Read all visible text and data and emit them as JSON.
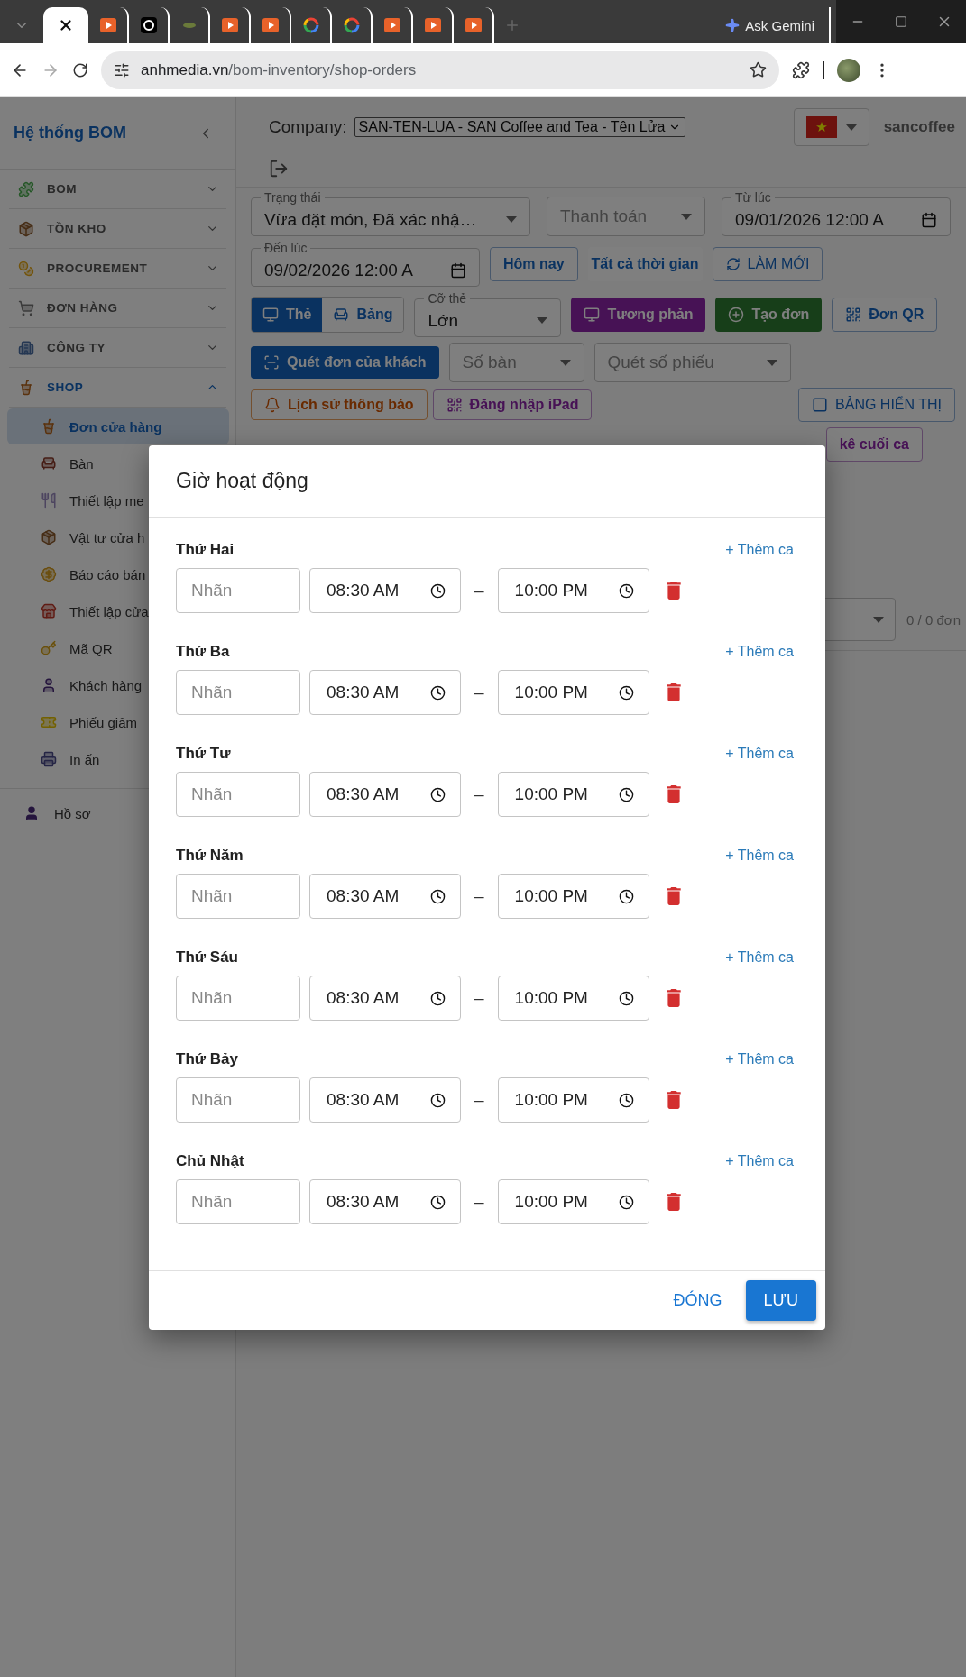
{
  "browser": {
    "tabs": [
      {
        "selected": true
      },
      {
        "selected": false
      },
      {
        "selected": false
      },
      {
        "selected": false
      },
      {
        "selected": false
      },
      {
        "selected": false
      },
      {
        "selected": false
      },
      {
        "selected": false
      },
      {
        "selected": false
      },
      {
        "selected": false
      },
      {
        "selected": false
      }
    ],
    "gemini": "Ask Gemini",
    "url_domain": "anhmedia.vn",
    "url_path": "/bom-inventory/shop-orders"
  },
  "sidebar": {
    "title": "Hệ thống BOM",
    "sections": [
      {
        "label": "BOM",
        "expanded": false
      },
      {
        "label": "TỒN KHO",
        "expanded": false
      },
      {
        "label": "PROCUREMENT",
        "expanded": false
      },
      {
        "label": "ĐƠN HÀNG",
        "expanded": false
      },
      {
        "label": "CÔNG TY",
        "expanded": false
      },
      {
        "label": "SHOP",
        "expanded": true,
        "children": [
          {
            "label": "Đơn cửa hàng",
            "selected": true
          },
          {
            "label": "Bàn",
            "selected": false
          },
          {
            "label": "Thiết lập me",
            "selected": false
          },
          {
            "label": "Vật tư cửa h",
            "selected": false
          },
          {
            "label": "Báo cáo bán",
            "selected": false
          },
          {
            "label": "Thiết lập cửa",
            "selected": false
          },
          {
            "label": "Mã QR",
            "selected": false
          },
          {
            "label": "Khách hàng",
            "selected": false
          },
          {
            "label": "Phiếu giảm",
            "selected": false
          },
          {
            "label": "In ấn",
            "selected": false
          }
        ]
      }
    ],
    "profile": "Hồ sơ"
  },
  "header": {
    "company_label": "Company:",
    "company": "SAN-TEN-LUA - SAN Coffee and Tea - Tên Lửa",
    "user": "sancoffee"
  },
  "filters": {
    "status": {
      "label": "Trạng thái",
      "value": "Vừa đặt món, Đã xác nhậ…"
    },
    "payment": {
      "placeholder": "Thanh toán"
    },
    "from": {
      "label": "Từ lúc",
      "value": "09/01/2026 12:00 A"
    },
    "to": {
      "label": "Đến lúc",
      "value": "09/02/2026 12:00 A"
    },
    "today": "Hôm nay",
    "all_time": "Tất cả thời gian",
    "refresh": "LÀM MỚI"
  },
  "view_modes": [
    {
      "label": "Thẻ",
      "selected": true
    },
    {
      "label": "Bảng",
      "selected": false
    }
  ],
  "card_size": {
    "label": "Cỡ thẻ",
    "value": "Lớn"
  },
  "actions": {
    "contrast": "Tương phản",
    "create": "Tạo đơn",
    "qr": "Đơn QR",
    "scan": "Quét đơn của khách",
    "table_placeholder": "Số bàn",
    "ticket_placeholder": "Quét số phiếu",
    "history": "Lịch sử thông báo",
    "ipad": "Đăng nhập iPad",
    "display": "BẢNG HIỂN THỊ",
    "shift_report": "kê cuối ca"
  },
  "order_count": "0 / 0 đơn",
  "dialog": {
    "title": "Giờ hoạt động",
    "days": [
      {
        "name": "Thứ Hai",
        "add_shift": "+ Thêm ca",
        "shifts": [
          {
            "placeholder": "Nhãn",
            "start": "08:30 AM",
            "dash": "–",
            "end": "10:00 PM"
          }
        ]
      },
      {
        "name": "Thứ Ba",
        "add_shift": "+ Thêm ca",
        "shifts": [
          {
            "placeholder": "Nhãn",
            "start": "08:30 AM",
            "dash": "–",
            "end": "10:00 PM"
          }
        ]
      },
      {
        "name": "Thứ Tư",
        "add_shift": "+ Thêm ca",
        "shifts": [
          {
            "placeholder": "Nhãn",
            "start": "08:30 AM",
            "dash": "–",
            "end": "10:00 PM"
          }
        ]
      },
      {
        "name": "Thứ Năm",
        "add_shift": "+ Thêm ca",
        "shifts": [
          {
            "placeholder": "Nhãn",
            "start": "08:30 AM",
            "dash": "–",
            "end": "10:00 PM"
          }
        ]
      },
      {
        "name": "Thứ Sáu",
        "add_shift": "+ Thêm ca",
        "shifts": [
          {
            "placeholder": "Nhãn",
            "start": "08:30 AM",
            "dash": "–",
            "end": "10:00 PM"
          }
        ]
      },
      {
        "name": "Thứ Bảy",
        "add_shift": "+ Thêm ca",
        "shifts": [
          {
            "placeholder": "Nhãn",
            "start": "08:30 AM",
            "dash": "–",
            "end": "10:00 PM"
          }
        ]
      },
      {
        "name": "Chủ Nhật",
        "add_shift": "+ Thêm ca",
        "shifts": [
          {
            "placeholder": "Nhãn",
            "start": "08:30 AM",
            "dash": "–",
            "end": "10:00 PM"
          }
        ]
      }
    ],
    "close": "ĐÓNG",
    "save": "LƯU"
  }
}
